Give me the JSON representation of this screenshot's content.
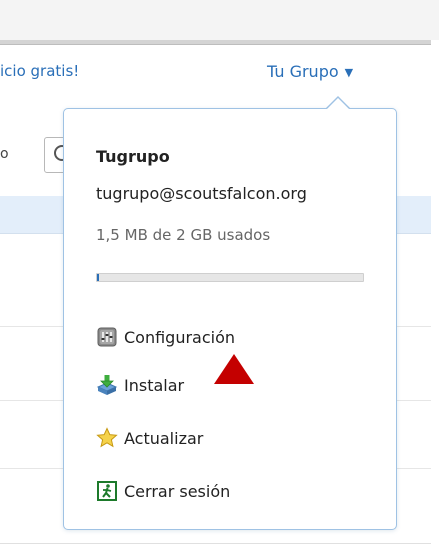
{
  "header": {
    "promo_link": "icio gratis!",
    "account_label": "Tu Grupo",
    "account_caret": "▼"
  },
  "background": {
    "fragment_text": "o"
  },
  "popover": {
    "display_name": "Tugrupo",
    "email": "tugrupo@scoutsfalcon.org",
    "usage_text": "1,5 MB de 2 GB usados",
    "usage_fraction": 0.0007,
    "menu": [
      {
        "label": "Configuración",
        "icon": "settings-icon"
      },
      {
        "label": "Instalar",
        "icon": "install-icon"
      },
      {
        "label": "Actualizar",
        "icon": "star-icon"
      },
      {
        "label": "Cerrar sesión",
        "icon": "exit-icon"
      }
    ]
  },
  "colors": {
    "link": "#2a6fb8",
    "popover_border": "#9fc2e4",
    "usage_fill": "#2a6fb8",
    "marker": "#c40000"
  }
}
